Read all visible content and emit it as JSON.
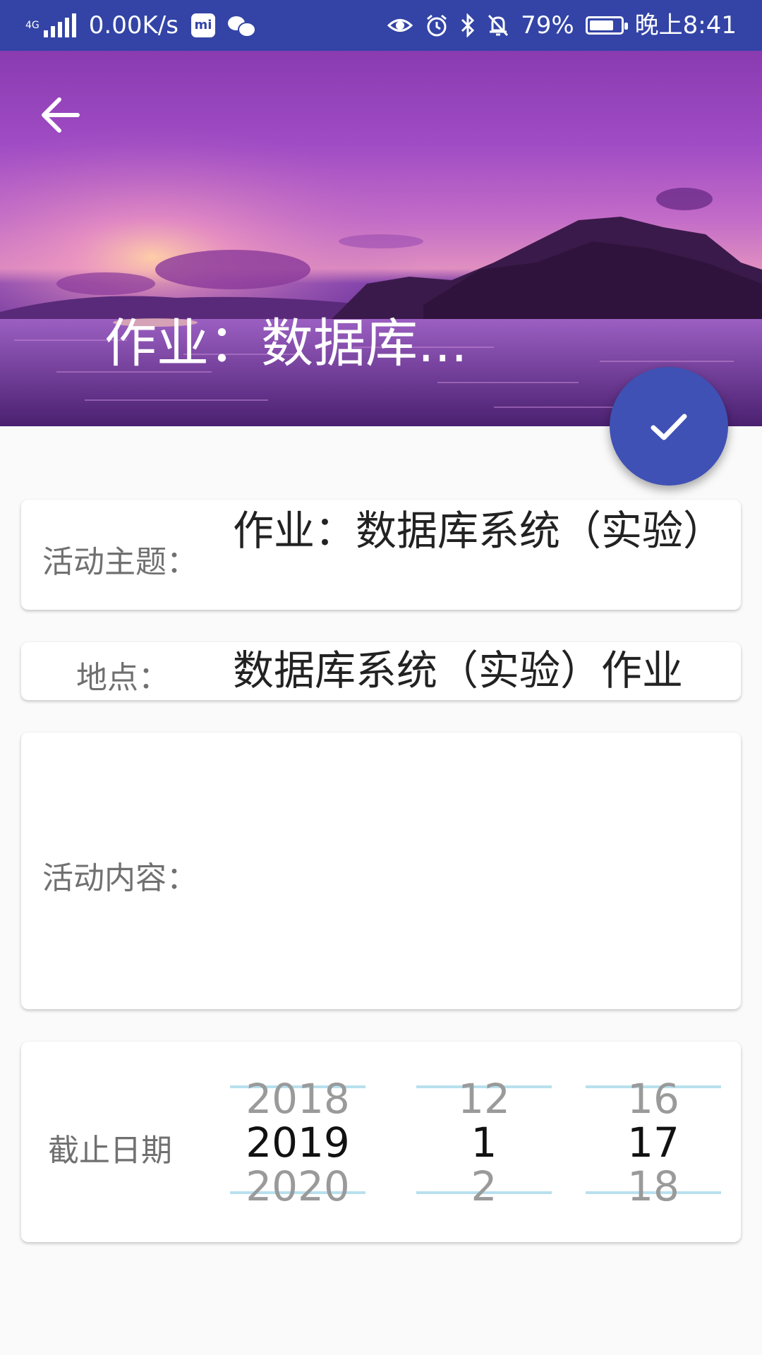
{
  "status_bar": {
    "network": "4G",
    "speed": "0.00K/s",
    "app_icon_label": "mi",
    "battery": "79%",
    "battery_level": 0.79,
    "time": "晚上8:41"
  },
  "header": {
    "title": "作业：数据库..."
  },
  "form": {
    "subject_label": "活动主题：",
    "subject_value": "作业：数据库系统（实验）",
    "location_label": "地点：",
    "location_value": "数据库系统（实验）作业",
    "content_label": "活动内容：",
    "content_value": "",
    "deadline_label": "截止日期"
  },
  "date_picker": {
    "year": {
      "prev": "2018",
      "selected": "2019",
      "next": "2020"
    },
    "month": {
      "prev": "12",
      "selected": "1",
      "next": "2"
    },
    "day": {
      "prev": "16",
      "selected": "17",
      "next": "18"
    }
  }
}
